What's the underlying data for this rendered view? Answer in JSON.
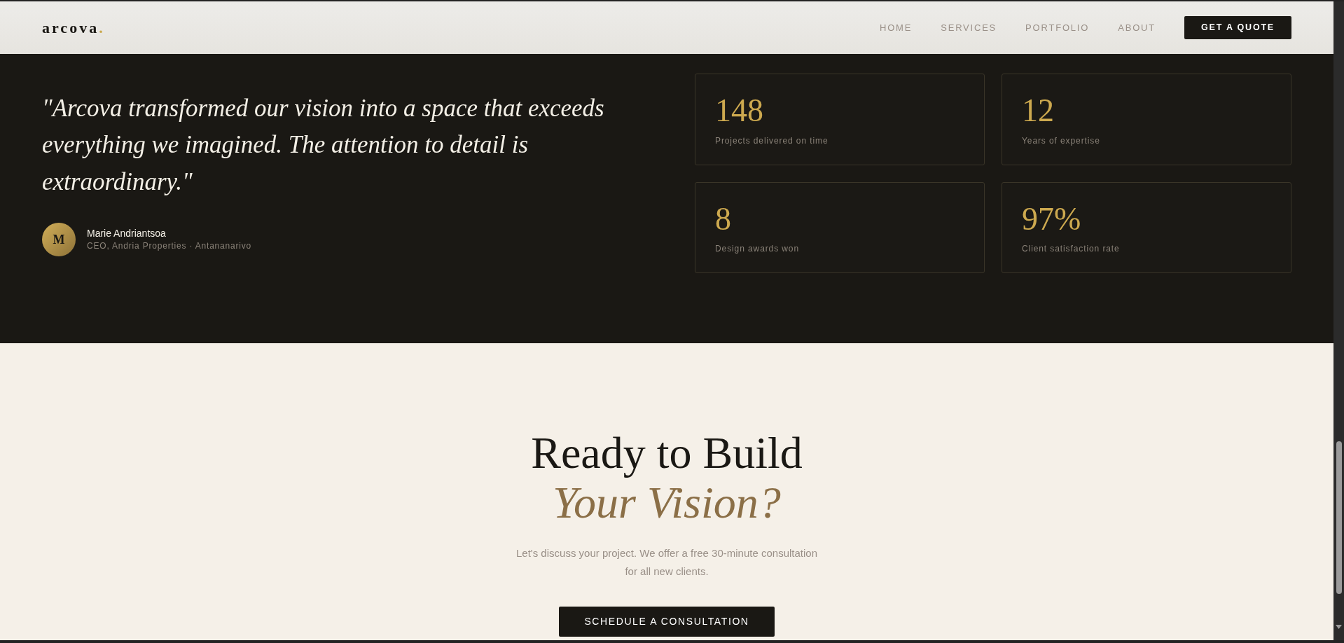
{
  "navbar": {
    "logo": {
      "text": "arcova",
      "accent": "."
    },
    "links": [
      "HOME",
      "SERVICES",
      "PORTFOLIO",
      "ABOUT"
    ],
    "cta_button": "GET A QUOTE"
  },
  "testimonial": {
    "quote": "\"Arcova transformed our vision into a space that exceeds everything we imagined. The attention to detail is extraordinary.\"",
    "author": {
      "initial": "M",
      "name": "Marie Andriantsoa",
      "role": "CEO, Andria Properties · Antananarivo"
    }
  },
  "stats": [
    {
      "value": "148",
      "label": "Projects delivered on time"
    },
    {
      "value": "12",
      "label": "Years of expertise"
    },
    {
      "value": "8",
      "label": "Design awards won"
    },
    {
      "value": "97%",
      "label": "Client satisfaction rate"
    }
  ],
  "cta": {
    "heading": "Ready to Build",
    "heading_accent": "Your Vision?",
    "text": "Let's discuss your project. We offer a free 30-minute consultation for all new clients.",
    "button": "SCHEDULE A CONSULTATION"
  }
}
